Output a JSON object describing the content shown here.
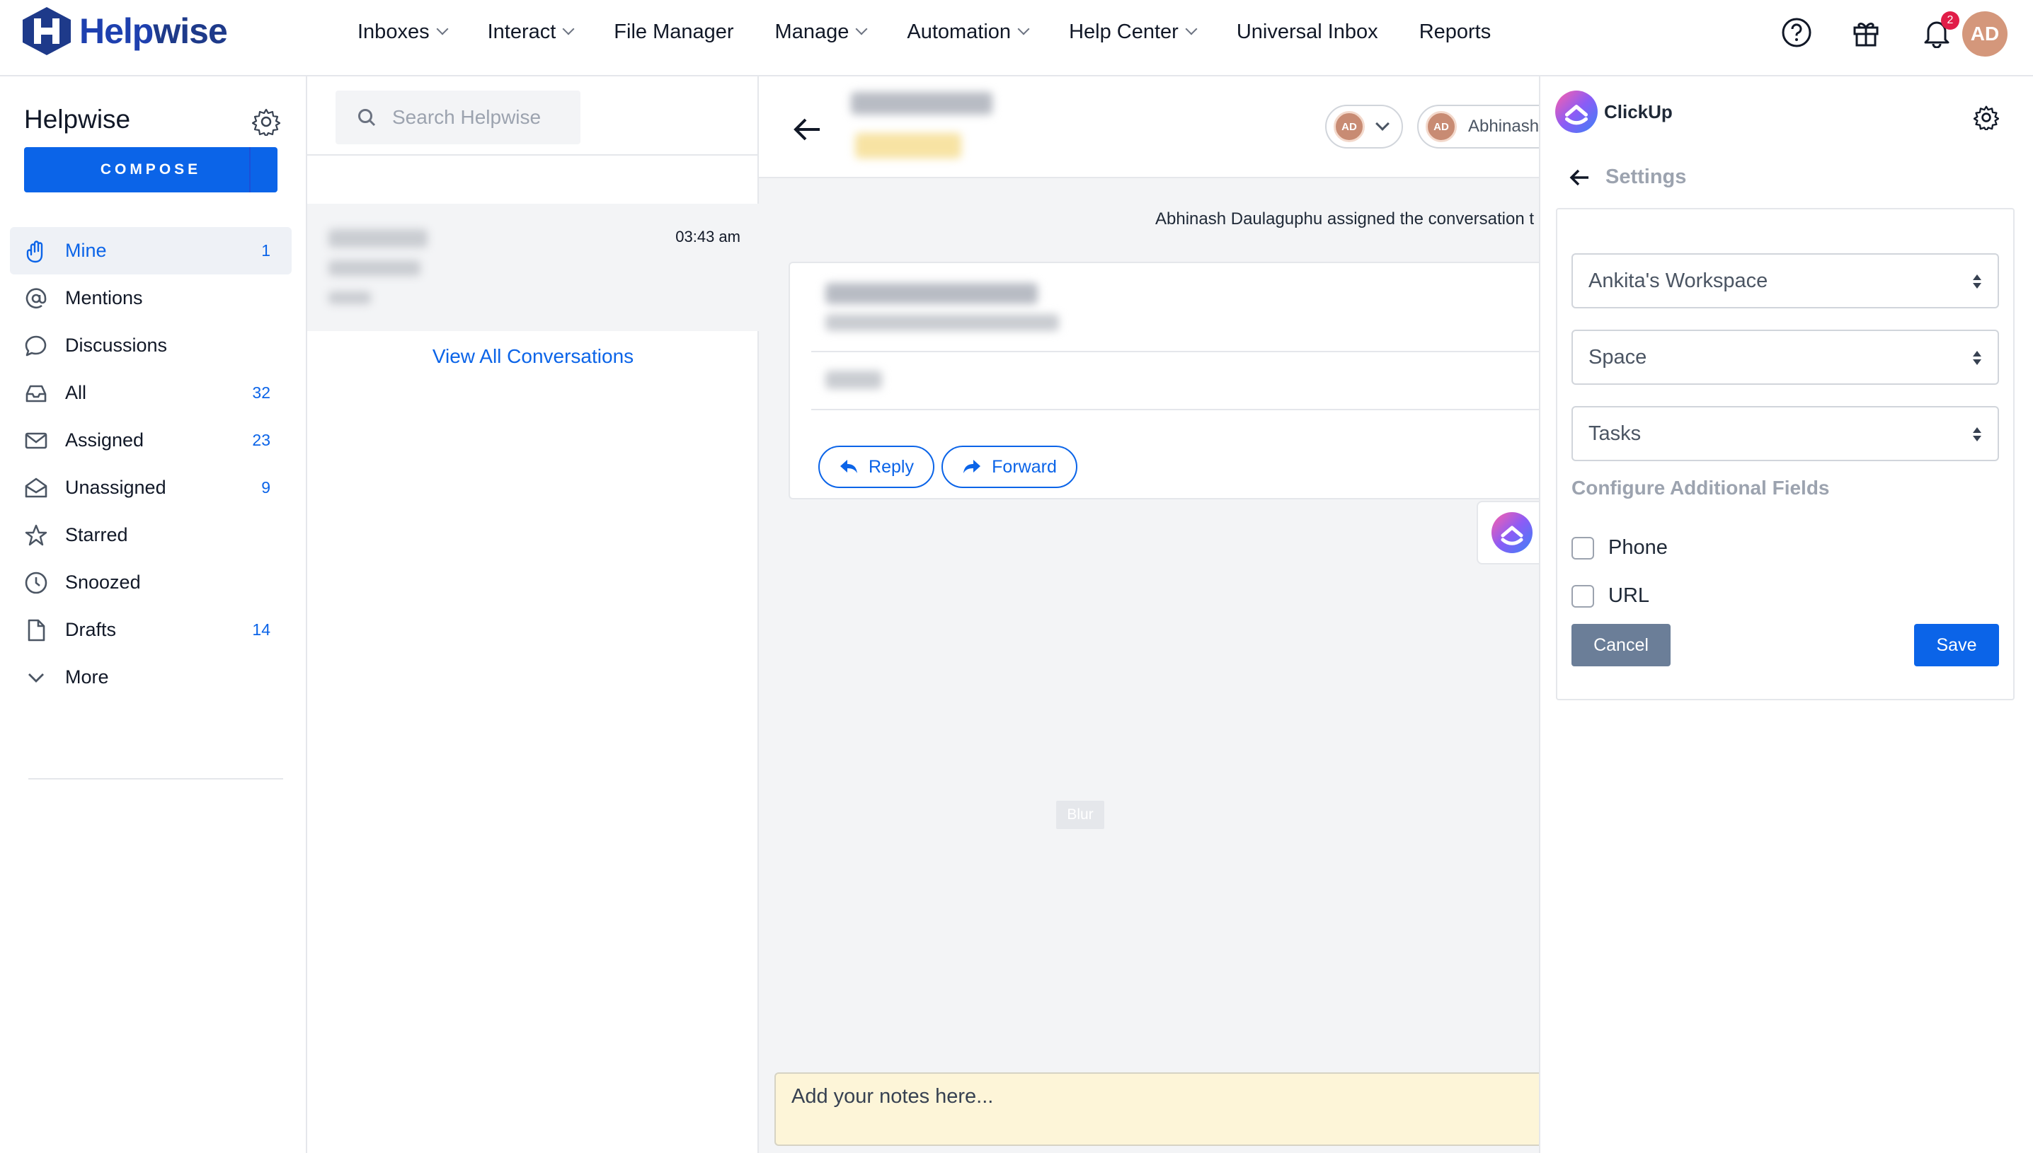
{
  "app": {
    "name_prefix": "Help",
    "name_suffix": "wise"
  },
  "topnav": {
    "items": [
      {
        "label": "Inboxes",
        "dropdown": true
      },
      {
        "label": "Interact",
        "dropdown": true
      },
      {
        "label": "File Manager",
        "dropdown": false
      },
      {
        "label": "Manage",
        "dropdown": true
      },
      {
        "label": "Automation",
        "dropdown": true
      },
      {
        "label": "Help Center",
        "dropdown": true
      },
      {
        "label": "Universal Inbox",
        "dropdown": false
      },
      {
        "label": "Reports",
        "dropdown": false
      }
    ],
    "notification_count": "2",
    "user_initials": "AD"
  },
  "sidebar": {
    "workspace_title": "Helpwise",
    "compose_label": "COMPOSE",
    "items": [
      {
        "label": "Mine",
        "count": "1",
        "icon": "hand-icon",
        "active": true
      },
      {
        "label": "Mentions",
        "count": "",
        "icon": "at-icon",
        "active": false
      },
      {
        "label": "Discussions",
        "count": "",
        "icon": "chat-bubble-icon",
        "active": false
      },
      {
        "label": "All",
        "count": "32",
        "icon": "inbox-tray-icon",
        "active": false
      },
      {
        "label": "Assigned",
        "count": "23",
        "icon": "envelope-icon",
        "active": false
      },
      {
        "label": "Unassigned",
        "count": "9",
        "icon": "envelope-open-icon",
        "active": false
      },
      {
        "label": "Starred",
        "count": "",
        "icon": "star-icon",
        "active": false
      },
      {
        "label": "Snoozed",
        "count": "",
        "icon": "clock-icon",
        "active": false
      },
      {
        "label": "Drafts",
        "count": "14",
        "icon": "file-icon",
        "active": false
      },
      {
        "label": "More",
        "count": "",
        "icon": "chevron-down-icon",
        "active": false
      }
    ]
  },
  "conversation_list": {
    "search_placeholder": "Search Helpwise",
    "selected_time": "03:43 am",
    "view_all_label": "View All Conversations"
  },
  "conversation": {
    "assign_avatar_initials": "AD",
    "assignee_initials": "AD",
    "assignee_name": "Abhinash",
    "activity_text": "Abhinash Daulaguphu assigned the conversation t",
    "reply_label": "Reply",
    "forward_label": "Forward",
    "notes_placeholder": "Add your notes here..."
  },
  "clickup": {
    "title": "ClickUp",
    "settings_label": "Settings",
    "workspace_value": "Ankita's Workspace",
    "space_value": "Space",
    "list_value": "Tasks",
    "additional_fields_label": "Configure Additional Fields",
    "fields": [
      {
        "label": "Phone",
        "checked": false
      },
      {
        "label": "URL",
        "checked": false
      }
    ],
    "cancel_label": "Cancel",
    "save_label": "Save"
  },
  "overlay": {
    "blur_label": "Blur"
  },
  "colors": {
    "primary": "#0b64e8",
    "brand_navy": "#1e3a8a",
    "notification": "#e11d48",
    "notes_bg": "#fdf5d8",
    "cancel_bg": "#6b7e98"
  }
}
